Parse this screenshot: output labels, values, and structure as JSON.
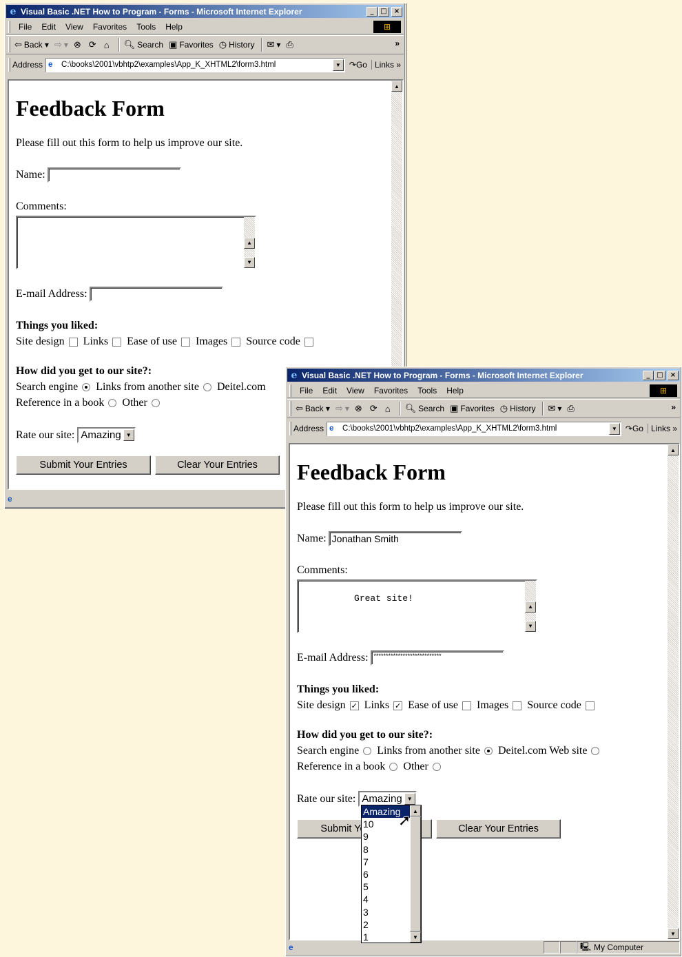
{
  "windows": [
    {
      "title": "Visual Basic .NET How to Program - Forms - Microsoft Internet Explorer",
      "menu": [
        "File",
        "Edit",
        "View",
        "Favorites",
        "Tools",
        "Help"
      ],
      "toolbar": {
        "back": "Back",
        "search": "Search",
        "favorites": "Favorites",
        "history": "History"
      },
      "address": {
        "label": "Address",
        "url": "C:\\books\\2001\\vbhtp2\\examples\\App_K_XHTML2\\form3.html",
        "go": "Go",
        "links": "Links"
      },
      "form": {
        "heading": "Feedback Form",
        "intro": "Please fill out this form to help us improve our site.",
        "name_label": "Name:",
        "name_value": "",
        "comments_label": "Comments:",
        "comments_value": "",
        "email_label": "E-mail Address:",
        "email_value": "",
        "liked_heading": "Things you liked:",
        "liked": [
          {
            "label": "Site design",
            "checked": false
          },
          {
            "label": "Links",
            "checked": false
          },
          {
            "label": "Ease of use",
            "checked": false
          },
          {
            "label": "Images",
            "checked": false
          },
          {
            "label": "Source code",
            "checked": false
          }
        ],
        "howto_heading": "How did you get to our site?:",
        "howto_line1": [
          {
            "label": "Search engine",
            "selected": true
          },
          {
            "label": "Links from another site",
            "selected": false
          },
          {
            "label": "Deitel.com",
            "selected": false
          }
        ],
        "howto_line2": [
          {
            "label": "Reference in a book",
            "selected": false
          },
          {
            "label": "Other",
            "selected": false
          }
        ],
        "rate_label": "Rate our site:",
        "rate_value": "Amazing",
        "submit": "Submit Your Entries",
        "clear": "Clear Your Entries"
      }
    },
    {
      "title": "Visual Basic .NET How to Program - Forms - Microsoft Internet Explorer",
      "menu": [
        "File",
        "Edit",
        "View",
        "Favorites",
        "Tools",
        "Help"
      ],
      "toolbar": {
        "back": "Back",
        "search": "Search",
        "favorites": "Favorites",
        "history": "History"
      },
      "address": {
        "label": "Address",
        "url": "C:\\books\\2001\\vbhtp2\\examples\\App_K_XHTML2\\form3.html",
        "go": "Go",
        "links": "Links"
      },
      "status_zone": "My Computer",
      "form": {
        "heading": "Feedback Form",
        "intro": "Please fill out this form to help us improve our site.",
        "name_label": "Name:",
        "name_value": "Jonathan Smith",
        "comments_label": "Comments:",
        "comments_value": "Great site!",
        "email_label": "E-mail Address:",
        "email_value": "****************************",
        "liked_heading": "Things you liked:",
        "liked": [
          {
            "label": "Site design",
            "checked": true
          },
          {
            "label": "Links",
            "checked": true
          },
          {
            "label": "Ease of use",
            "checked": false
          },
          {
            "label": "Images",
            "checked": false
          },
          {
            "label": "Source code",
            "checked": false
          }
        ],
        "howto_heading": "How did you get to our site?:",
        "howto_line1": [
          {
            "label": "Search engine",
            "selected": false
          },
          {
            "label": "Links from another site",
            "selected": true
          },
          {
            "label": "Deitel.com Web site",
            "selected": false
          }
        ],
        "howto_line2": [
          {
            "label": "Reference in a book",
            "selected": false
          },
          {
            "label": "Other",
            "selected": false
          }
        ],
        "rate_label": "Rate our site:",
        "rate_value": "Amazing",
        "rate_options": [
          "Amazing",
          "10",
          "9",
          "8",
          "7",
          "6",
          "5",
          "4",
          "3",
          "2",
          "1"
        ],
        "submit": "Submit Your Entries",
        "clear": "Clear Your Entries"
      }
    }
  ]
}
